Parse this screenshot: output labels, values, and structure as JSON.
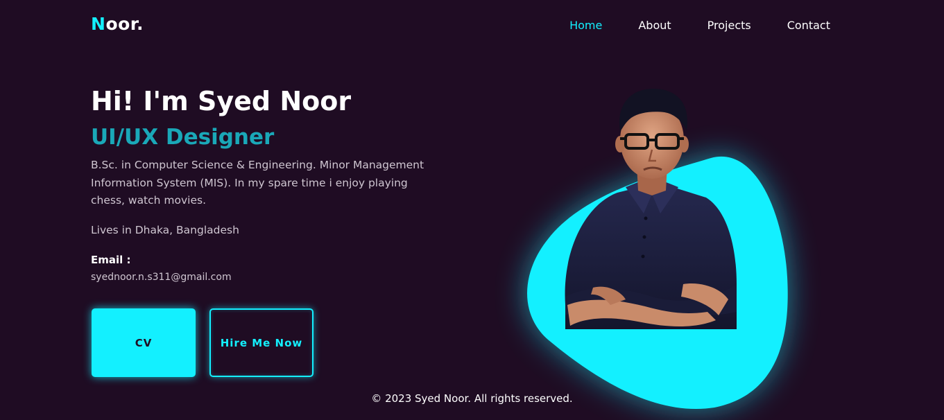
{
  "brand": {
    "logo_first": "N",
    "logo_rest": "oor."
  },
  "nav": {
    "items": [
      {
        "label": "Home",
        "active": true
      },
      {
        "label": "About",
        "active": false
      },
      {
        "label": "Projects",
        "active": false
      },
      {
        "label": "Contact",
        "active": false
      }
    ]
  },
  "hero": {
    "headline": "Hi! I'm Syed Noor",
    "role": "UI/UX Designer",
    "bio": "B.Sc. in Computer Science & Engineering. Minor Management Information System (MIS). In my spare time i enjoy playing chess, watch movies.",
    "location": "Lives in Dhaka, Bangladesh",
    "email_label": "Email :",
    "email": "syednoor.n.s311@gmail.com"
  },
  "buttons": {
    "cv": "CV",
    "hire": "Hire Me Now"
  },
  "footer": {
    "copyright": "© 2023 Syed Noor. All rights reserved."
  },
  "colors": {
    "background": "#1f0c23",
    "accent": "#13f0ff",
    "role_text": "#1aa8b8",
    "shirt": "#1b1d3c"
  }
}
